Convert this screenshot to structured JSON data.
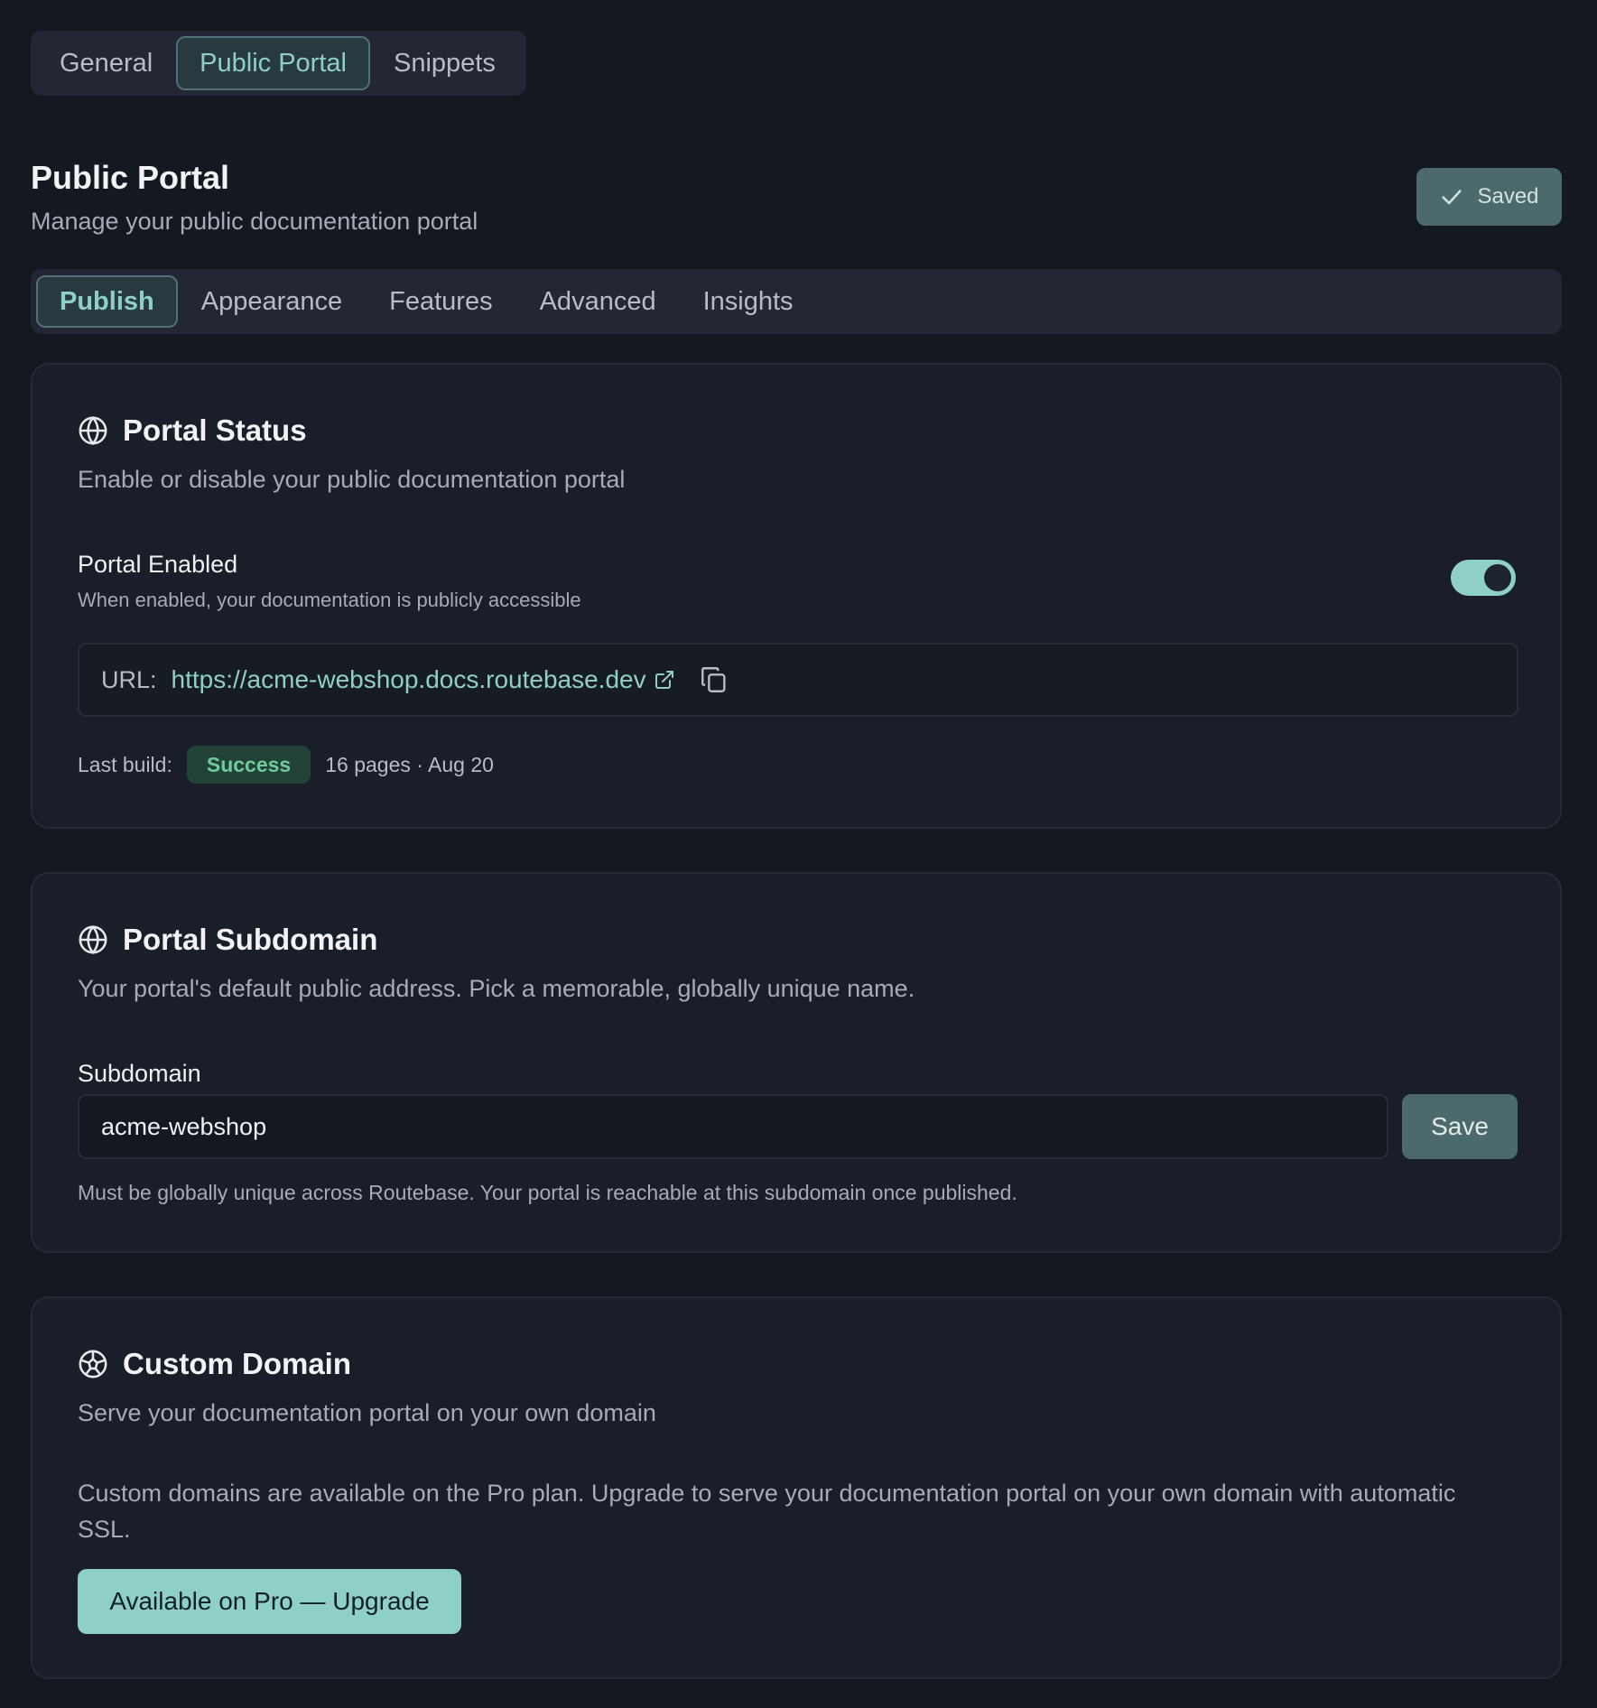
{
  "top_tabs": [
    {
      "label": "General"
    },
    {
      "label": "Public Portal"
    },
    {
      "label": "Snippets"
    }
  ],
  "header": {
    "title": "Public Portal",
    "subtitle": "Manage your public documentation portal",
    "saved_label": "Saved"
  },
  "sub_tabs": [
    {
      "label": "Publish"
    },
    {
      "label": "Appearance"
    },
    {
      "label": "Features"
    },
    {
      "label": "Advanced"
    },
    {
      "label": "Insights"
    }
  ],
  "portal_status": {
    "title": "Portal Status",
    "description": "Enable or disable your public documentation portal",
    "toggle_label": "Portal Enabled",
    "toggle_description": "When enabled, your documentation is publicly accessible",
    "enabled": true,
    "url_label": "URL:",
    "url": "https://acme-webshop.docs.routebase.dev",
    "build_label": "Last build:",
    "build_status": "Success",
    "build_meta": "16 pages · Aug 20"
  },
  "portal_subdomain": {
    "title": "Portal Subdomain",
    "description": "Your portal's default public address. Pick a memorable, globally unique name.",
    "field_label": "Subdomain",
    "value": "acme-webshop",
    "save_label": "Save",
    "help": "Must be globally unique across Routebase. Your portal is reachable at this subdomain once published."
  },
  "custom_domain": {
    "title": "Custom Domain",
    "description": "Serve your documentation portal on your own domain",
    "upgrade_text": "Custom domains are available on the Pro plan. Upgrade to serve your documentation portal on your own domain with automatic SSL.",
    "upgrade_label": "Available on Pro — Upgrade"
  },
  "colors": {
    "background": "#141821",
    "card": "#1a1e28",
    "accent": "#8fd0c6",
    "success": "#6fcc9a"
  }
}
